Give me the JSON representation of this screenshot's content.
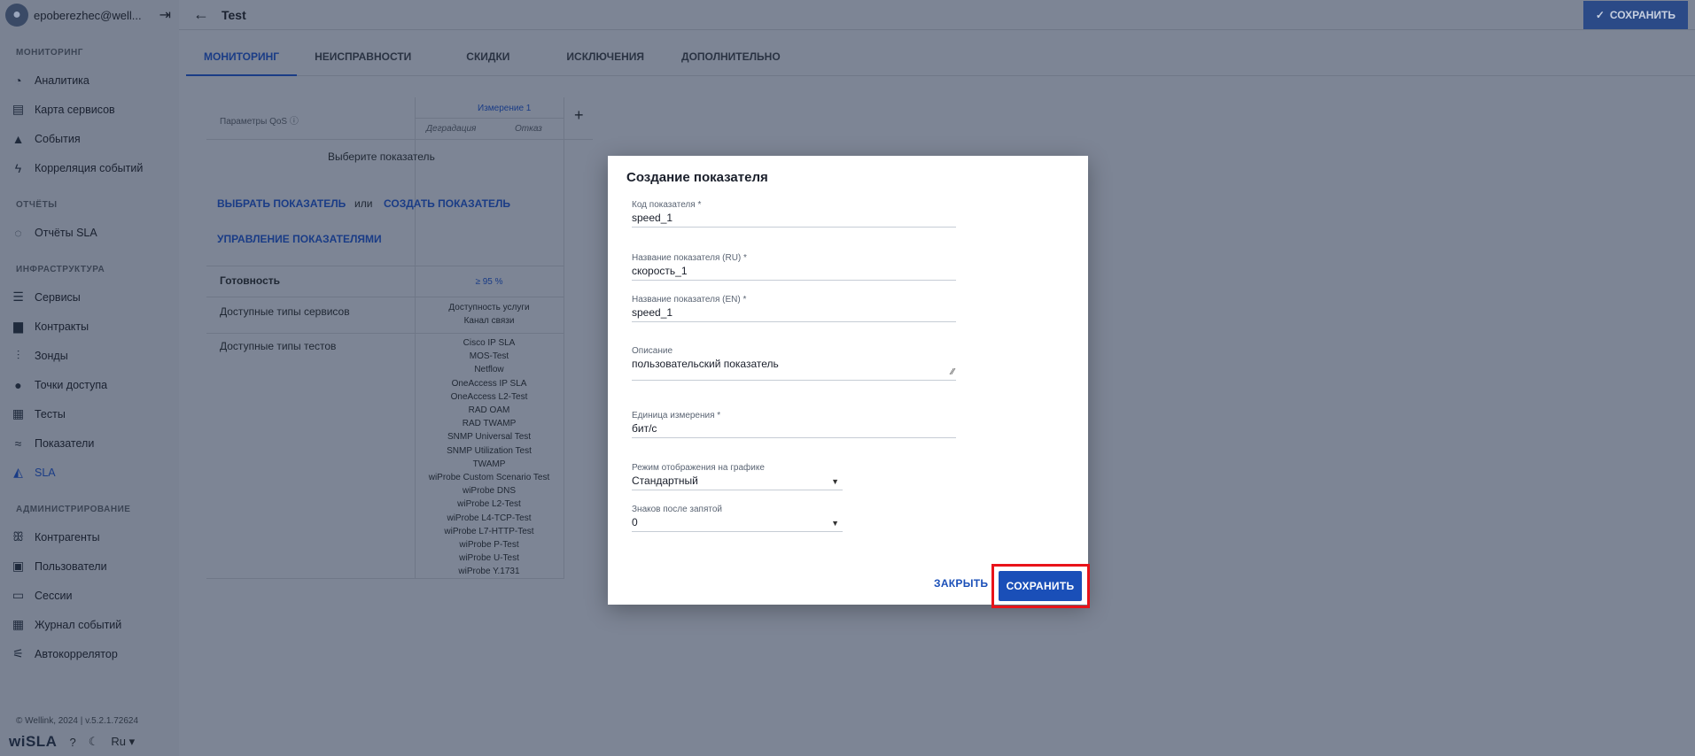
{
  "sidebar": {
    "user": "epoberezhec@well...",
    "sections": [
      {
        "title": "МОНИТОРИНГ",
        "items": [
          {
            "label": "Аналитика",
            "icon": "pie-chart-icon"
          },
          {
            "label": "Карта сервисов",
            "icon": "map-icon"
          },
          {
            "label": "События",
            "icon": "warning-icon"
          },
          {
            "label": "Корреляция событий",
            "icon": "bolt-icon"
          }
        ]
      },
      {
        "title": "ОТЧЁТЫ",
        "items": [
          {
            "label": "Отчёты SLA",
            "icon": "report-icon"
          }
        ]
      },
      {
        "title": "ИНФРАСТРУКТУРА",
        "items": [
          {
            "label": "Сервисы",
            "icon": "list-icon"
          },
          {
            "label": "Контракты",
            "icon": "document-icon"
          },
          {
            "label": "Зонды",
            "icon": "probe-icon"
          },
          {
            "label": "Точки доступа",
            "icon": "circle-icon"
          },
          {
            "label": "Тесты",
            "icon": "checklist-icon"
          },
          {
            "label": "Показатели",
            "icon": "metrics-icon"
          },
          {
            "label": "SLA",
            "icon": "sla-icon"
          }
        ]
      },
      {
        "title": "АДМИНИСТРИРОВАНИЕ",
        "items": [
          {
            "label": "Контрагенты",
            "icon": "people-icon"
          },
          {
            "label": "Пользователи",
            "icon": "user-card-icon"
          },
          {
            "label": "Сессии",
            "icon": "window-icon"
          },
          {
            "label": "Журнал событий",
            "icon": "calendar-icon"
          },
          {
            "label": "Автокоррелятор",
            "icon": "sliders-icon"
          }
        ]
      }
    ],
    "copyright": "© Wellink, 2024 | v.5.2.1.72624",
    "logo": "wiSLA",
    "lang": "Ru"
  },
  "header": {
    "title": "Test",
    "save_label": "СОХРАНИТЬ"
  },
  "tabs": [
    "МОНИТОРИНГ",
    "НЕИСПРАВНОСТИ",
    "СКИДКИ",
    "ИСКЛЮЧЕНИЯ",
    "ДОПОЛНИТЕЛЬНО"
  ],
  "qos": {
    "params_label": "Параметры QoS",
    "measurement": "Измерение 1",
    "degradation": "Деградация",
    "failure": "Отказ",
    "choose": "Выберите показатель",
    "select_link": "ВЫБРАТЬ ПОКАЗАТЕЛЬ",
    "or": "или",
    "create_link": "СОЗДАТЬ ПОКАЗАТЕЛЬ",
    "manage_link": "УПРАВЛЕНИЕ ПОКАЗАТЕЛЯМИ",
    "readiness_label": "Готовность",
    "readiness_value": "≥ 95 %",
    "service_types_label": "Доступные типы сервисов",
    "service_types": [
      "Доступность услуги",
      "Канал связи"
    ],
    "test_types_label": "Доступные типы тестов",
    "test_types": [
      "Cisco IP SLA",
      "MOS-Test",
      "Netflow",
      "OneAccess IP SLA",
      "OneAccess L2-Test",
      "RAD OAM",
      "RAD TWAMP",
      "SNMP Universal Test",
      "SNMP Utilization Test",
      "TWAMP",
      "wiProbe Custom Scenario Test",
      "wiProbe DNS",
      "wiProbe L2-Test",
      "wiProbe L4-TCP-Test",
      "wiProbe L7-HTTP-Test",
      "wiProbe P-Test",
      "wiProbe U-Test",
      "wiProbe Y.1731"
    ]
  },
  "modal": {
    "title": "Создание показателя",
    "code_label": "Код показателя *",
    "code_value": "speed_1",
    "name_ru_label": "Название показателя (RU) *",
    "name_ru_value": "скорость_1",
    "name_en_label": "Название показателя (EN) *",
    "name_en_value": "speed_1",
    "desc_label": "Описание",
    "desc_value": "пользовательский показатель",
    "unit_label": "Единица измерения *",
    "unit_value": "бит/с",
    "mode_label": "Режим отображения на графике",
    "mode_value": "Стандартный",
    "decimals_label": "Знаков после запятой",
    "decimals_value": "0",
    "close_label": "ЗАКРЫТЬ",
    "save_label": "СОХРАНИТЬ"
  }
}
